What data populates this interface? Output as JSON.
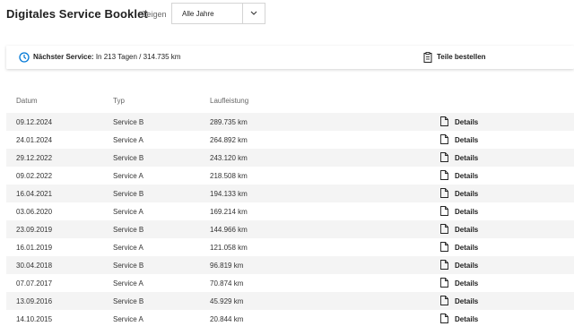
{
  "header": {
    "title": "Digitales Service Booklet",
    "filter_label": "Zeigen",
    "filter_value": "Alle Jahre"
  },
  "service": {
    "next_label": "Nächster Service:",
    "next_value": "In 213 Tagen / 314.735 km",
    "order_label": "Teile bestellen"
  },
  "table": {
    "columns": [
      "Datum",
      "Typ",
      "Laufleistung"
    ],
    "details_label": "Details",
    "rows": [
      {
        "date": "09.12.2024",
        "type": "Service B",
        "km": "289.735 km"
      },
      {
        "date": "24.01.2024",
        "type": "Service A",
        "km": "264.892 km"
      },
      {
        "date": "29.12.2022",
        "type": "Service B",
        "km": "243.120 km"
      },
      {
        "date": "09.02.2022",
        "type": "Service A",
        "km": "218.508 km"
      },
      {
        "date": "16.04.2021",
        "type": "Service B",
        "km": "194.133 km"
      },
      {
        "date": "03.06.2020",
        "type": "Service A",
        "km": "169.214 km"
      },
      {
        "date": "23.09.2019",
        "type": "Service B",
        "km": "144.966 km"
      },
      {
        "date": "16.01.2019",
        "type": "Service A",
        "km": "121.058 km"
      },
      {
        "date": "30.04.2018",
        "type": "Service B",
        "km": "96.819 km"
      },
      {
        "date": "07.07.2017",
        "type": "Service A",
        "km": "70.874 km"
      },
      {
        "date": "13.09.2016",
        "type": "Service B",
        "km": "45.929 km"
      },
      {
        "date": "14.10.2015",
        "type": "Service A",
        "km": "20.844 km"
      }
    ]
  },
  "colors": {
    "accent": "#0078d6",
    "row_stripe": "#f4f4f4",
    "muted_text": "#666666"
  },
  "icons": {
    "next_service": "clock-icon",
    "order": "clipboard-icon",
    "details": "document-icon",
    "dropdown": "chevron-down-icon"
  }
}
